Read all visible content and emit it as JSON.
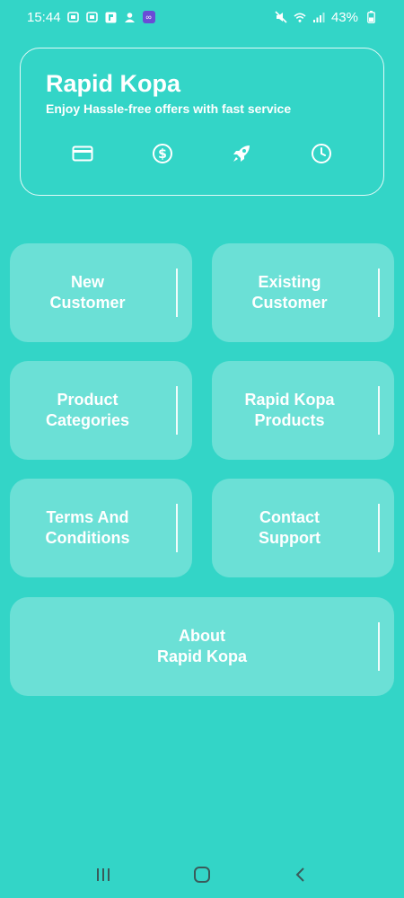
{
  "status_bar": {
    "time": "15:44",
    "battery": "43%",
    "left_icons": [
      "notification-icon",
      "notification-icon",
      "flipboard-icon",
      "profile-icon",
      "loop-app-icon"
    ],
    "right_icons": [
      "mute-icon",
      "wifi-icon",
      "signal-icon",
      "battery-icon"
    ]
  },
  "header": {
    "title": "Rapid Kopa",
    "subtitle": "Enjoy Hassle-free offers with fast service",
    "icons": [
      "card-icon",
      "dollar-icon",
      "rocket-icon",
      "clock-icon"
    ]
  },
  "tiles": [
    {
      "label": "New\nCustomer"
    },
    {
      "label": "Existing\nCustomer"
    },
    {
      "label": "Product\nCategories"
    },
    {
      "label": "Rapid Kopa\nProducts"
    },
    {
      "label": "Terms And\nConditions"
    },
    {
      "label": "Contact\nSupport"
    },
    {
      "label": "About\nRapid Kopa"
    }
  ],
  "nav": {
    "icons": [
      "recent-apps-icon",
      "home-icon",
      "back-icon"
    ]
  },
  "colors": {
    "background": "#33d5c7",
    "tile": "#71e4da",
    "text": "#ffffff"
  }
}
